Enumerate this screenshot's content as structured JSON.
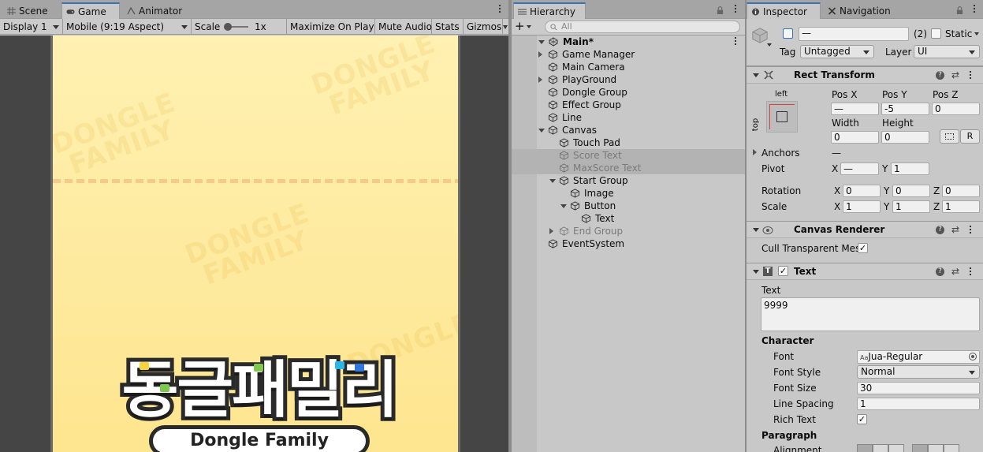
{
  "left_panel": {
    "tabs": [
      {
        "label": "Scene",
        "icon": "grid-icon"
      },
      {
        "label": "Game",
        "icon": "gamepad-icon"
      },
      {
        "label": "Animator",
        "icon": "animator-icon"
      }
    ],
    "toolbar": {
      "display": "Display 1",
      "aspect": "Mobile (9:19 Aspect)",
      "scale_label": "Scale",
      "scale_value": "1x",
      "maximize": "Maximize On Play",
      "mute": "Mute Audio",
      "stats": "Stats",
      "gizmos": "Gizmos"
    },
    "game": {
      "watermark_line1": "DONGLE",
      "watermark_line2": "FAMILY",
      "logo_korean": "동글패밀리",
      "logo_english": "Dongle Family"
    }
  },
  "hierarchy": {
    "tab_label": "Hierarchy",
    "search_placeholder": "All",
    "scene_name": "Main*",
    "items": [
      {
        "label": "Game Manager",
        "expandable": true,
        "expanded": false,
        "depth": 1,
        "disabled": false
      },
      {
        "label": "Main Camera",
        "expandable": false,
        "depth": 1,
        "disabled": false
      },
      {
        "label": "PlayGround",
        "expandable": true,
        "expanded": false,
        "depth": 1,
        "disabled": false
      },
      {
        "label": "Dongle Group",
        "expandable": false,
        "depth": 1,
        "disabled": false
      },
      {
        "label": "Effect Group",
        "expandable": false,
        "depth": 1,
        "disabled": false
      },
      {
        "label": "Line",
        "expandable": false,
        "depth": 1,
        "disabled": false
      },
      {
        "label": "Canvas",
        "expandable": true,
        "expanded": true,
        "depth": 1,
        "disabled": false
      },
      {
        "label": "Touch Pad",
        "expandable": false,
        "depth": 2,
        "disabled": false
      },
      {
        "label": "Score Text",
        "expandable": false,
        "depth": 2,
        "disabled": true,
        "selected": true
      },
      {
        "label": "MaxScore Text",
        "expandable": false,
        "depth": 2,
        "disabled": true,
        "selected": true
      },
      {
        "label": "Start Group",
        "expandable": true,
        "expanded": true,
        "depth": 2,
        "disabled": false
      },
      {
        "label": "Image",
        "expandable": false,
        "depth": 3,
        "disabled": false
      },
      {
        "label": "Button",
        "expandable": true,
        "expanded": true,
        "depth": 3,
        "disabled": false
      },
      {
        "label": "Text",
        "expandable": false,
        "depth": 4,
        "disabled": false
      },
      {
        "label": "End Group",
        "expandable": true,
        "expanded": false,
        "depth": 2,
        "disabled": true
      },
      {
        "label": "EventSystem",
        "expandable": false,
        "depth": 1,
        "disabled": false
      }
    ]
  },
  "inspector": {
    "tabs": [
      {
        "label": "Inspector",
        "icon": "info-icon"
      },
      {
        "label": "Navigation",
        "icon": "navigation-icon"
      }
    ],
    "object": {
      "name": "—",
      "count": "(2)",
      "static_label": "Static",
      "tag_label": "Tag",
      "tag_value": "Untagged",
      "layer_label": "Layer",
      "layer_value": "UI"
    },
    "rect_transform": {
      "title": "Rect Transform",
      "anchor_h": "left",
      "anchor_v": "top",
      "posx_label": "Pos X",
      "posx": "—",
      "posy_label": "Pos Y",
      "posy": "-5",
      "posz_label": "Pos Z",
      "posz": "0",
      "width_label": "Width",
      "width": "0",
      "height_label": "Height",
      "height": "0",
      "r_button": "R",
      "anchors_label": "Anchors",
      "anchors_value": "—",
      "pivot_label": "Pivot",
      "pivot_x": "—",
      "pivot_y": "1",
      "rotation_label": "Rotation",
      "rot_x": "0",
      "rot_y": "0",
      "rot_z": "0",
      "scale_label": "Scale",
      "scale_x": "1",
      "scale_y": "1",
      "scale_z": "1",
      "x": "X",
      "y": "Y",
      "z": "Z"
    },
    "canvas_renderer": {
      "title": "Canvas Renderer",
      "cull_label": "Cull Transparent Mes",
      "cull_checked": true
    },
    "text": {
      "title": "Text",
      "text_label": "Text",
      "text_value": "9999",
      "character_label": "Character",
      "font_label": "Font",
      "font_value": "Jua-Regular",
      "font_style_label": "Font Style",
      "font_style_value": "Normal",
      "font_size_label": "Font Size",
      "font_size_value": "30",
      "line_spacing_label": "Line Spacing",
      "line_spacing_value": "1",
      "rich_text_label": "Rich Text",
      "rich_text_checked": true,
      "paragraph_label": "Paragraph",
      "alignment_label": "Alignment"
    }
  },
  "colors": {
    "accent": "#3a72b0",
    "game_bg_top": "#fff1b2",
    "game_bg_bottom": "#fee58f",
    "dashed_line": "#f7c98a"
  }
}
